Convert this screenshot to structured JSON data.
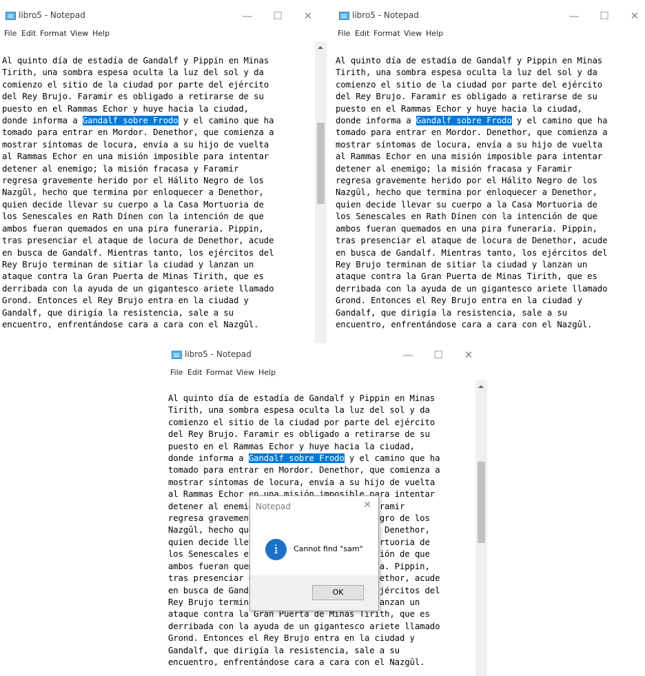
{
  "windows": [
    {
      "title": "libro5 - Notepad",
      "controls": {
        "minimize": "—",
        "maximize": "☐",
        "close": "✕"
      },
      "menu": [
        "File",
        "Edit",
        "Format",
        "View",
        "Help"
      ],
      "lines_before": [
        "Al quinto día de estadía de Gandalf y Pippin en Minas",
        "Tirith, una sombra espesa oculta la luz del sol y da",
        "comienzo el sitio de la ciudad por parte del ejército",
        "del Rey Brujo. Faramir es obligado a retirarse de su",
        "puesto en el Rammas Echor y huye hacia la ciudad,"
      ],
      "sel_line": {
        "pre": "donde informa a ",
        "sel": "Gandalf sobre Frodo",
        "post": " y el camino que ha"
      },
      "lines_after": [
        "tomado para entrar en Mordor. Denethor, que comienza a",
        "mostrar síntomas de locura, envía a su hijo de vuelta",
        "al Rammas Echor en una misión imposible para intentar",
        "detener al enemigo; la misión fracasa y Faramir",
        "regresa gravemente herido por el Hálito Negro de los",
        "Nazgûl, hecho que termina por enloquecer a Denethor,",
        "quien decide llevar su cuerpo a la Casa Mortuoria de",
        "los Senescales en Rath Dínen con la intención de que",
        "ambos fueran quemados en una pira funeraria. Pippin,",
        "tras presenciar el ataque de locura de Denethor, acude",
        "en busca de Gandalf. Mientras tanto, los ejércitos del",
        "Rey Brujo terminan de sitiar la ciudad y lanzan un",
        "ataque contra la Gran Puerta de Minas Tirith, que es",
        "derribada con la ayuda de un gigantesco ariete llamado",
        "Grond. Entonces el Rey Brujo entra en la ciudad y",
        "Gandalf, que dirigía la resistencia, sale a su",
        "encuentro, enfrentándose cara a cara con el Nazgûl."
      ]
    },
    {
      "title": "libro5 - Notepad",
      "controls": {
        "minimize": "—",
        "maximize": "☐",
        "close": "✕"
      },
      "menu": [
        "File",
        "Edit",
        "Format",
        "View",
        "Help"
      ],
      "lines_before": [
        "Al quinto día de estadía de Gandalf y Pippin en Minas",
        "Tirith, una sombra espesa oculta la luz del sol y da",
        "comienzo el sitio de la ciudad por parte del ejército",
        "del Rey Brujo. Faramir es obligado a retirarse de su",
        "puesto en el Rammas Echor y huye hacia la ciudad,"
      ],
      "sel_line": {
        "pre": "donde informa a ",
        "sel": "Gandalf sobre Frodo",
        "post": " y el camino que ha"
      },
      "lines_after": [
        "tomado para entrar en Mordor. Denethor, que comienza a",
        "mostrar síntomas de locura, envía a su hijo de vuelta",
        "al Rammas Echor en una misión imposible para intentar",
        "detener al enemigo; la misión fracasa y Faramir",
        "regresa gravemente herido por el Hálito Negro de los",
        "Nazgûl, hecho que termina por enloquecer a Denethor,",
        "quien decide llevar su cuerpo a la Casa Mortuoria de",
        "los Senescales en Rath Dínen con la intención de que",
        "ambos fueran quemados en una pira funeraria. Pippin,",
        "tras presenciar el ataque de locura de Denethor, acude",
        "en busca de Gandalf. Mientras tanto, los ejércitos del",
        "Rey Brujo terminan de sitiar la ciudad y lanzan un",
        "ataque contra la Gran Puerta de Minas Tirith, que es",
        "derribada con la ayuda de un gigantesco ariete llamado",
        "Grond. Entonces el Rey Brujo entra en la ciudad y",
        "Gandalf, que dirigía la resistencia, sale a su",
        "encuentro, enfrentándose cara a cara con el Nazgûl."
      ]
    },
    {
      "title": "libro5 - Notepad",
      "controls": {
        "minimize": "—",
        "maximize": "☐",
        "close": "✕"
      },
      "menu": [
        "File",
        "Edit",
        "Format",
        "View",
        "Help"
      ],
      "lines_before": [
        "Al quinto día de estadía de Gandalf y Pippin en Minas",
        "Tirith, una sombra espesa oculta la luz del sol y da",
        "comienzo el sitio de la ciudad por parte del ejército",
        "del Rey Brujo. Faramir es obligado a retirarse de su",
        "puesto en el Rammas Echor y huye hacia la ciudad,"
      ],
      "sel_line": {
        "pre": "donde informa a ",
        "sel": "Gandalf sobre Frodo",
        "post": " y el camino que ha"
      },
      "lines_after": [
        "tomado para entrar en Mordor. Denethor, que comienza a",
        "mostrar síntomas de locura, envía a su hijo de vuelta",
        "al Rammas Echor en una misión imposible para intentar",
        "detener al enemigo; la misión fracasa y Faramir",
        "regresa gravemente herido por el Hálito Negro de los",
        "Nazgûl, hecho que termina por enloquecer a Denethor,",
        "quien decide llevar su cuerpo a la Casa Mortuoria de",
        "los Senescales en Rath Dínen con la intención de que",
        "ambos fueran quemados en una pira funeraria. Pippin,",
        "tras presenciar el ataque de locura de Denethor, acude",
        "en busca de Gandalf. Mientras tanto, los ejércitos del",
        "Rey Brujo terminan de sitiar la ciudad y lanzan un",
        "ataque contra la Gran Puerta de Minas Tirith, que es",
        "derribada con la ayuda de un gigantesco ariete llamado",
        "Grond. Entonces el Rey Brujo entra en la ciudad y",
        "Gandalf, que dirigía la resistencia, sale a su",
        "encuentro, enfrentándose cara a cara con el Nazgûl."
      ]
    }
  ],
  "dialog": {
    "title": "Notepad",
    "close": "✕",
    "icon": "i",
    "icon_name": "info-icon",
    "message": "Cannot find \"sam\"",
    "ok_label": "OK"
  },
  "colors": {
    "selection": "#0078d7",
    "info_icon": "#1a73c9"
  }
}
